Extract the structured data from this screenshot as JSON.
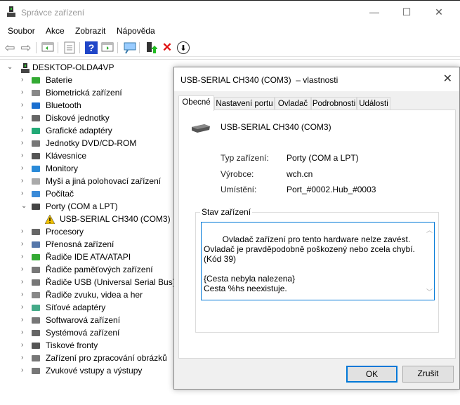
{
  "window": {
    "title": "Správce zařízení",
    "minimize": "—",
    "maximize": "☐",
    "close": "✕"
  },
  "menu": [
    "Soubor",
    "Akce",
    "Zobrazit",
    "Nápověda"
  ],
  "toolbar": {
    "back": "⇦",
    "forward": "⇨",
    "delete": "✕",
    "update": "⬇",
    "help": "?"
  },
  "tree": {
    "root": "DESKTOP-OLDA4VP",
    "items": [
      {
        "label": "Baterie",
        "icon": "battery-icon"
      },
      {
        "label": "Biometrická zařízení",
        "icon": "fingerprint-icon"
      },
      {
        "label": "Bluetooth",
        "icon": "bluetooth-icon"
      },
      {
        "label": "Diskové jednotky",
        "icon": "disk-icon"
      },
      {
        "label": "Grafické adaptéry",
        "icon": "display-adapter-icon"
      },
      {
        "label": "Jednotky DVD/CD-ROM",
        "icon": "dvd-icon"
      },
      {
        "label": "Klávesnice",
        "icon": "keyboard-icon"
      },
      {
        "label": "Monitory",
        "icon": "monitor-icon"
      },
      {
        "label": "Myši a jiná polohovací zařízení",
        "icon": "mouse-icon"
      },
      {
        "label": "Počítač",
        "icon": "computer-icon"
      },
      {
        "label": "Porty (COM a LPT)",
        "icon": "port-icon",
        "expanded": true
      },
      {
        "label": "USB-SERIAL CH340 (COM3)",
        "icon": "warning-icon",
        "child": true
      },
      {
        "label": "Procesory",
        "icon": "processor-icon"
      },
      {
        "label": "Přenosná zařízení",
        "icon": "portable-device-icon"
      },
      {
        "label": "Řadiče IDE ATA/ATAPI",
        "icon": "ide-icon"
      },
      {
        "label": "Řadiče paměťových zařízení",
        "icon": "storage-icon"
      },
      {
        "label": "Řadiče USB (Universal Serial Bus)",
        "icon": "usb-icon"
      },
      {
        "label": "Řadiče zvuku, videa a her",
        "icon": "sound-icon"
      },
      {
        "label": "Síťové adaptéry",
        "icon": "network-icon"
      },
      {
        "label": "Softwarová zařízení",
        "icon": "software-icon"
      },
      {
        "label": "Systémová zařízení",
        "icon": "system-icon"
      },
      {
        "label": "Tiskové fronty",
        "icon": "printer-icon"
      },
      {
        "label": "Zařízení pro zpracování obrázků",
        "icon": "camera-icon"
      },
      {
        "label": "Zvukové vstupy a výstupy",
        "icon": "speaker-icon"
      }
    ]
  },
  "dialog": {
    "title": "USB-SERIAL CH340 (COM3)  – vlastnosti",
    "close": "✕",
    "tabs": [
      "Obecné",
      "Nastavení portu",
      "Ovladač",
      "Podrobnosti",
      "Události"
    ],
    "device_name": "USB-SERIAL CH340 (COM3)",
    "props": [
      {
        "label": "Typ zařízení:",
        "value": "Porty (COM a LPT)"
      },
      {
        "label": "Výrobce:",
        "value": "wch.cn"
      },
      {
        "label": "Umístění:",
        "value": "Port_#0002.Hub_#0003"
      }
    ],
    "status_title": "Stav zařízení",
    "status_text": "Ovladač zařízení pro tento hardware nelze zavést. Ovladač je pravděpodobně poškozený nebo zcela chybí. (Kód 39)\n\n{Cesta nebyla nalezena}\nCesta %hs neexistuje.",
    "ok": "OK",
    "cancel": "Zrušit"
  }
}
